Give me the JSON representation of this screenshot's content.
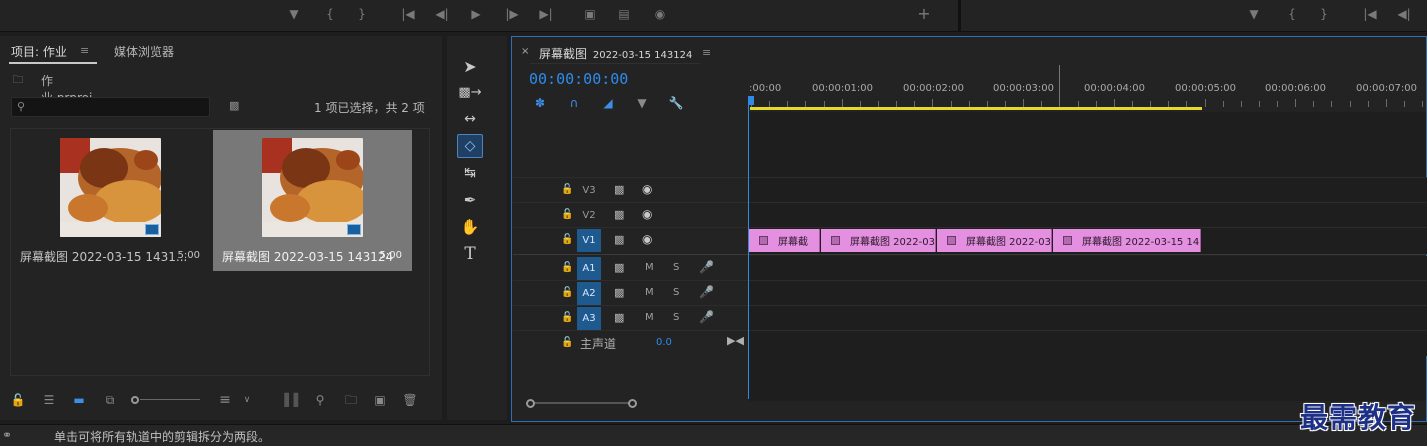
{
  "top_monitor_controls": {
    "icons": [
      "marker-icon",
      "mark-in-icon",
      "mark-out-icon",
      "go-to-in-icon",
      "step-back-icon",
      "play-icon",
      "step-forward-icon",
      "go-to-out-icon",
      "lift-icon",
      "extract-icon",
      "export-frame-icon",
      "add-icon",
      "marker-icon",
      "mark-in-icon",
      "mark-out-icon",
      "go-to-in-icon",
      "step-back-icon"
    ]
  },
  "project_panel": {
    "tab_project": "项目: 作业",
    "tab_media_browser": "媒体浏览器",
    "project_file": "作业.prproj",
    "search_placeholder": "",
    "selection_status": "1 项已选择，共 2 项",
    "items": [
      {
        "name": "屏幕截图 2022-03-15 1431...",
        "duration": "5:00",
        "selected": false
      },
      {
        "name": "屏幕截图 2022-03-15 143124",
        "duration": "5:00",
        "selected": true
      }
    ]
  },
  "timeline": {
    "sequence_name": "屏幕截图",
    "sequence_date": "2022-03-15 143124",
    "timecode": "00:00:00:00",
    "ruler_labels": [
      ":00:00",
      "00:00:01:00",
      "00:00:02:00",
      "00:00:03:00",
      "00:00:04:00",
      "00:00:05:00",
      "00:00:06:00",
      "00:00:07:00"
    ],
    "video_tracks": [
      "V3",
      "V2",
      "V1"
    ],
    "audio_tracks": [
      "A1",
      "A2",
      "A3"
    ],
    "audio_mute": "M",
    "audio_solo": "S",
    "master_track": "主声道",
    "master_value": "0.0",
    "clips": [
      {
        "label": "屏幕截"
      },
      {
        "label": "屏幕截图 2022-03"
      },
      {
        "label": "屏幕截图 2022-03"
      },
      {
        "label": "屏幕截图 2022-03-15 1431"
      }
    ]
  },
  "status_bar": {
    "text": "单击可将所有轨道中的剪辑拆分为两段。"
  },
  "watermark": "最需教育",
  "colors": {
    "accent_blue": "#2d8ceb",
    "clip_pink": "#e48fe0",
    "work_area_yellow": "#e6d92c",
    "track_active_blue": "#1f5a8f"
  }
}
